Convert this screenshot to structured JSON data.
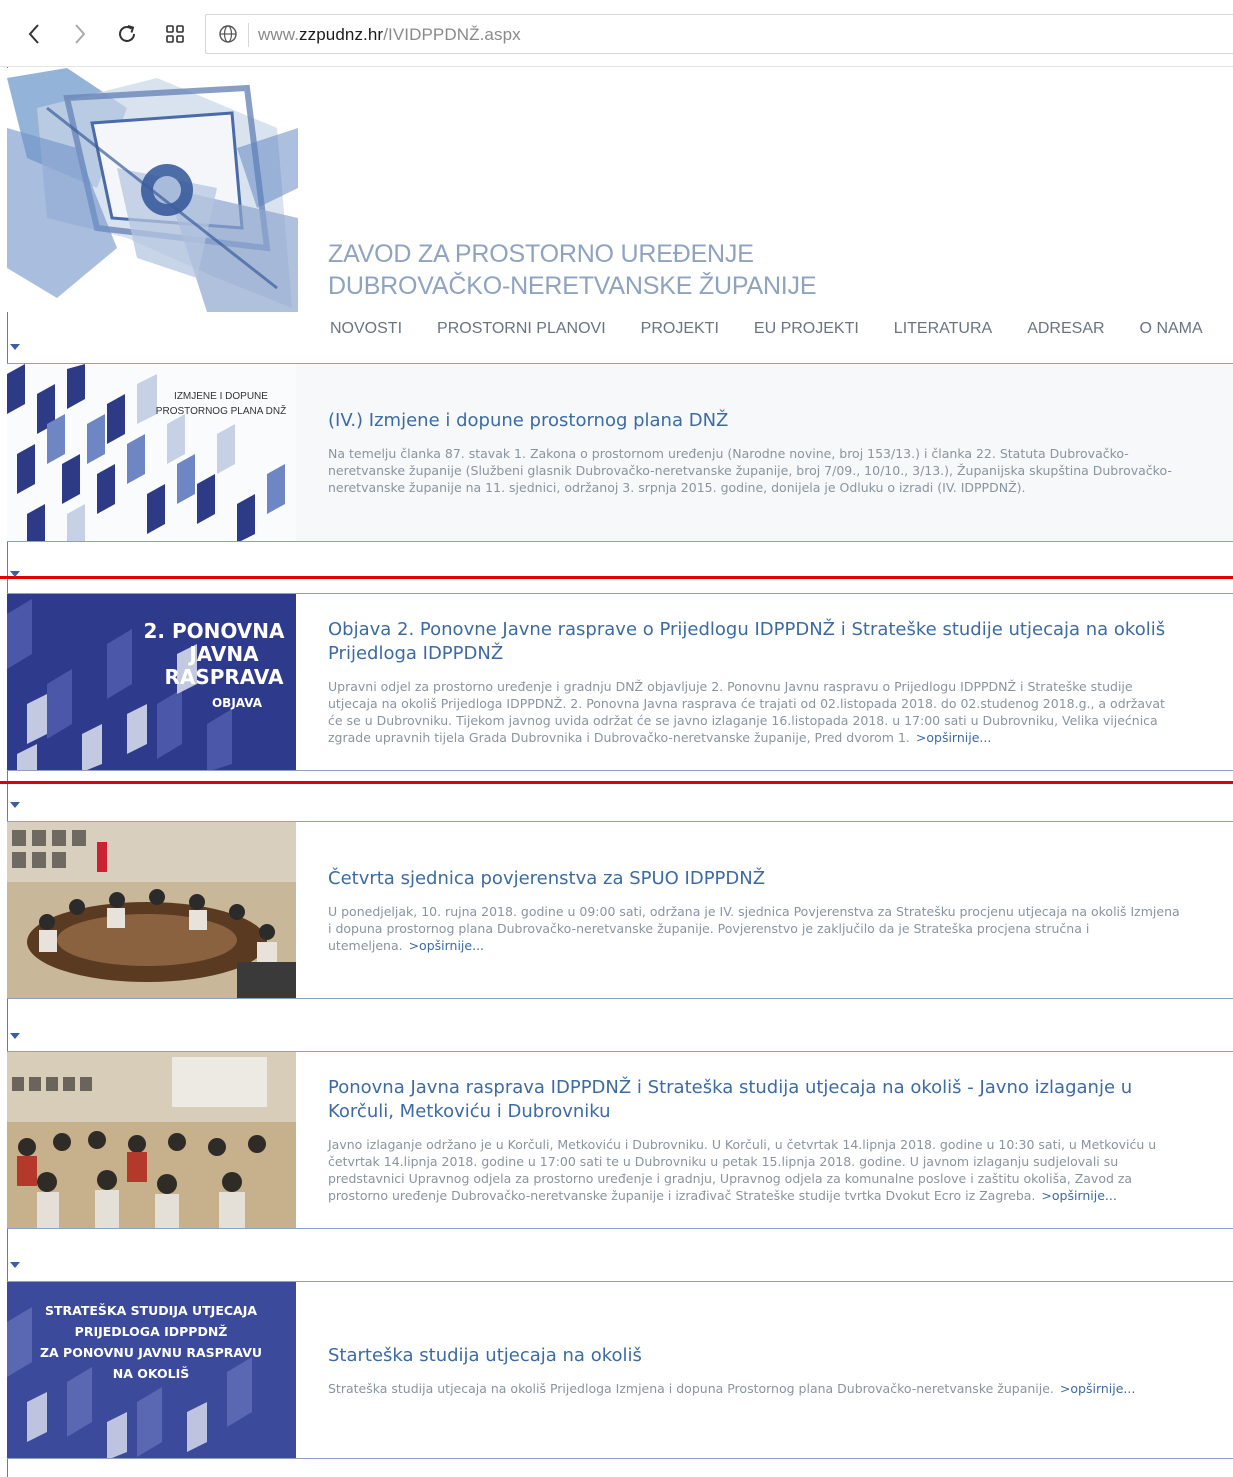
{
  "browser": {
    "url_prefix": "www.",
    "url_domain": "zzpudnz.hr",
    "url_path": "/IVIDPPDNŽ.aspx",
    "back_icon": "chevron-left-icon",
    "forward_icon": "chevron-right-icon",
    "reload_icon": "reload-icon",
    "grid_icon": "apps-grid-icon",
    "site_icon": "globe-icon"
  },
  "header": {
    "title_line1": "ZAVOD ZA PROSTORNO UREĐENJE",
    "title_line2": "DUBROVAČKO-NERETVANSKE ŽUPANIJE"
  },
  "nav": [
    {
      "label": "NOVOSTI"
    },
    {
      "label": "PROSTORNI PLANOVI"
    },
    {
      "label": "PROJEKTI"
    },
    {
      "label": "EU PROJEKTI"
    },
    {
      "label": "LITERATURA"
    },
    {
      "label": "ADRESAR"
    },
    {
      "label": "O NAMA"
    }
  ],
  "news": [
    {
      "thumb_caption_1": "IZMJENE I DOPUNE",
      "thumb_caption_2": "PROSTORNOG PLANA DNŽ",
      "title": "(IV.) Izmjene i dopune prostornog plana DNŽ",
      "body": "Na temelju članka 87. stavak 1. Zakona o prostornom uređenju (Narodne novine, broj 153/13.) i članka 22. Statuta Dubrovačko-neretvanske županije (Službeni glasnik Dubrovačko-neretvanske županije, broj 7/09., 10/10., 3/13.), Županijska skupština Dubrovačko-neretvanske županije na 11. sjednici, održanoj 3. srpnja 2015. godine, donijela je Odluku o izradi (IV. IDPPDNŽ).",
      "more": ""
    },
    {
      "thumb_caption_1": "2. PONOVNA",
      "thumb_caption_2": "JAVNA",
      "thumb_caption_3": "RASPRAVA",
      "thumb_caption_4": "OBJAVA",
      "title": "Objava 2. Ponovne Javne rasprave o Prijedlogu IDPPDNŽ i Strateške studije utjecaja na okoliš Prijedloga IDPPDNŽ",
      "body": "Upravni odjel za prostorno uređenje i gradnju DNŽ objavljuje 2. Ponovnu Javnu raspravu o Prijedlogu IDPPDNŽ i Strateške studije utjecaja na okoliš Prijedloga IDPPDNŽ. 2. Ponovna Javna rasprava će trajati od 02.listopada 2018. do 02.studenog 2018.g., a održavat će se u Dubrovniku. Tijekom javnog uvida održat će se javno izlaganje 16.listopada 2018. u 17:00 sati u Dubrovniku, Velika vijećnica zgrade upravnih tijela Grada Dubrovnika i Dubrovačko-neretvanske županije, Pred dvorom 1.",
      "more": ">opširnije..."
    },
    {
      "title": "Četvrta sjednica povjerenstva za SPUO IDPPDNŽ",
      "body": "U ponedjeljak, 10. rujna 2018. godine u 09:00 sati, održana je IV. sjednica Povjerenstva za Stratešku procjenu utjecaja na okoliš Izmjena i dopuna prostornog plana Dubrovačko-neretvanske županije. Povjerenstvo je zaključilo da je Strateška procjena stručna i utemeljena.",
      "more": ">opširnije..."
    },
    {
      "title": "Ponovna Javna rasprava IDPPDNŽ i Strateška studija utjecaja na okoliš - Javno izlaganje u Korčuli, Metkoviću i Dubrovniku",
      "body": "Javno izlaganje održano je u Korčuli, Metkoviću i Dubrovniku. U Korčuli, u četvrtak 14.lipnja 2018. godine u 10:30 sati, u Metkoviću u četvrtak 14.lipnja 2018. godine u 17:00 sati te u Dubrovniku u petak 15.lipnja 2018. godine. U javnom izlaganju sudjelovali su predstavnici Upravnog odjela za prostorno uređenje i gradnju, Upravnog odjela za komunalne poslove i zaštitu okoliša, Zavod za prostorno uređenje Dubrovačko-neretvanske županije i izrađivač Strateške studije tvrtka Dvokut Ecro iz Zagreba.",
      "more": ">opširnije..."
    },
    {
      "thumb_caption_1": "STRATEŠKA STUDIJA UTJECAJA",
      "thumb_caption_2": "PRIJEDLOGA IDPPDNŽ",
      "thumb_caption_3": "ZA PONOVNU JAVNU RASPRAVU",
      "thumb_caption_4": "NA OKOLIŠ",
      "title": "Starteška studija utjecaja na okoliš",
      "body": "Strateška studija utjecaja na okoliš Prijedloga Izmjena i dopuna Prostornog plana Dubrovačko-neretvanske županije.",
      "more": ">opširnije..."
    }
  ],
  "colors": {
    "accent_blue": "#3c6ba4",
    "title_blue": "#8fa3bf",
    "thumb_navy": "#2e3a8c",
    "highlight_red": "#e00000"
  }
}
